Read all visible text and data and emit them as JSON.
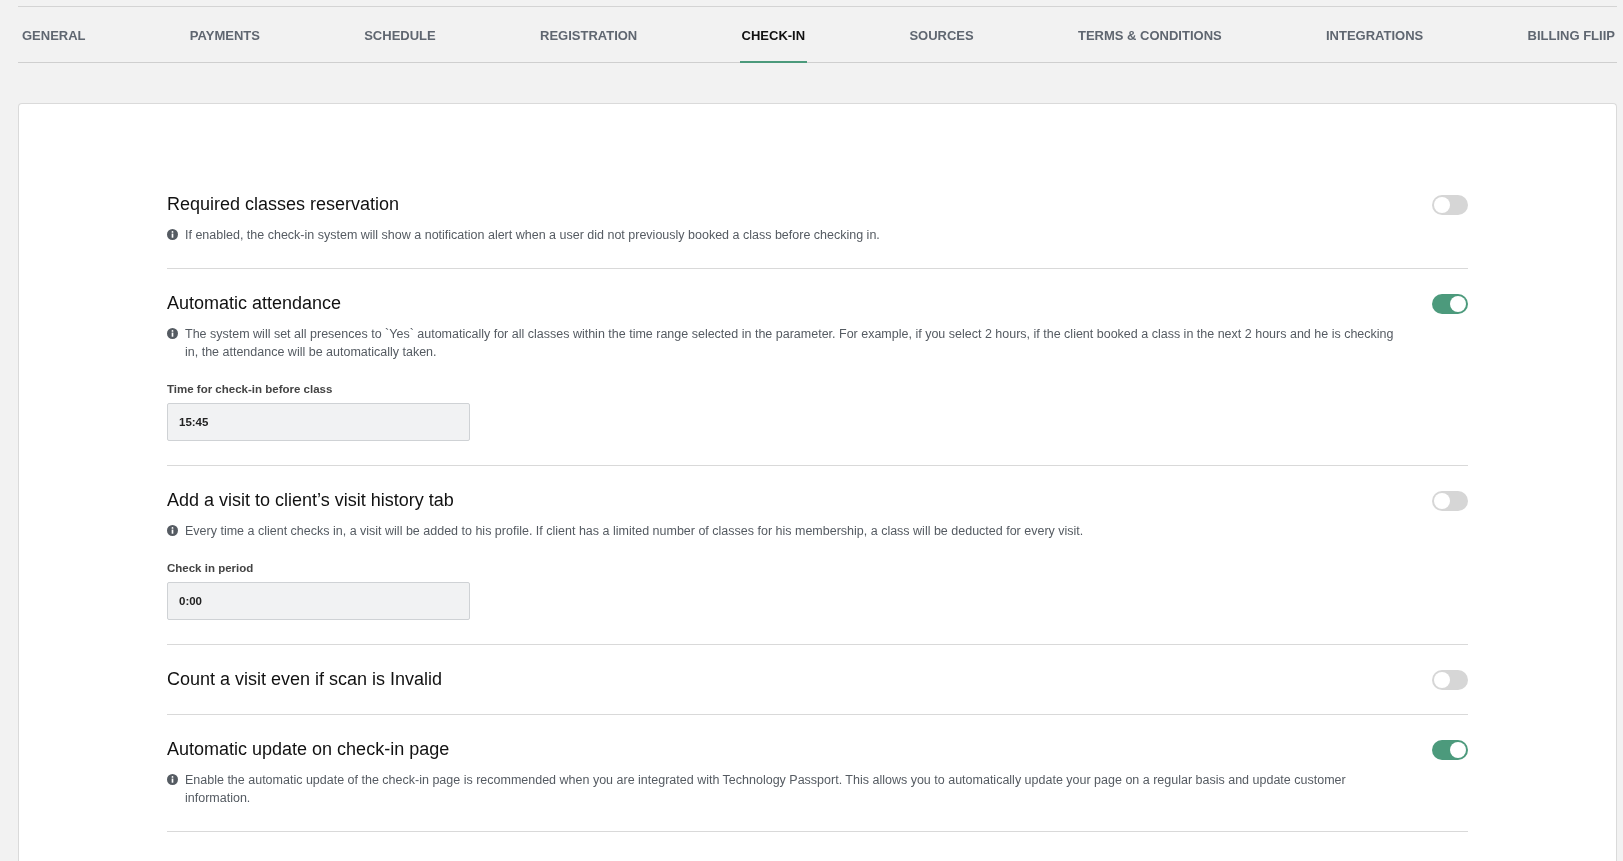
{
  "tabs": [
    {
      "label": "GENERAL",
      "selected": false
    },
    {
      "label": "PAYMENTS",
      "selected": false
    },
    {
      "label": "SCHEDULE",
      "selected": false
    },
    {
      "label": "REGISTRATION",
      "selected": false
    },
    {
      "label": "CHECK-IN",
      "selected": true
    },
    {
      "label": "SOURCES",
      "selected": false
    },
    {
      "label": "TERMS & CONDITIONS",
      "selected": false
    },
    {
      "label": "INTEGRATIONS",
      "selected": false
    },
    {
      "label": "BILLING FLIIP",
      "selected": false
    }
  ],
  "settings": [
    {
      "title": "Required classes reservation",
      "on": false,
      "description": "If enabled, the check-in system will show a notification alert when a user did not previously booked a class before checking in."
    },
    {
      "title": "Automatic attendance",
      "on": true,
      "description": "The system will set all presences to `Yes` automatically for all classes within the time range selected in the parameter. For example, if you select 2 hours, if the client booked a class in the next 2 hours and he is checking in, the attendance will be automatically taken.",
      "field": {
        "label": "Time for check-in before class",
        "value": "15:45"
      }
    },
    {
      "title": "Add a visit to client’s visit history tab",
      "on": false,
      "description": "Every time a client checks in, a visit will be added to his profile. If client has a limited number of classes for his membership, a class will be deducted for every visit.",
      "field": {
        "label": "Check in period",
        "value": "0:00"
      }
    },
    {
      "title": "Count a visit even if scan is Invalid",
      "on": false
    },
    {
      "title": "Automatic update on check-in page",
      "on": true,
      "description": "Enable the automatic update of the check-in page is recommended when you are integrated with Technology Passport. This allows you to automatically update your page on a regular basis and update customer information."
    }
  ]
}
